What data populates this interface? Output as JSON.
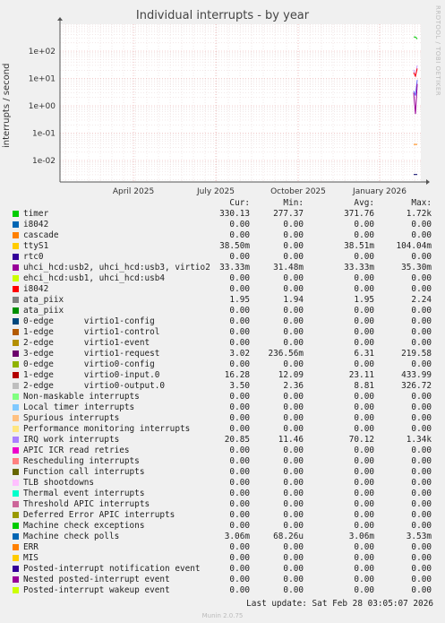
{
  "title": "Individual interrupts - by year",
  "side_label": "RRDTOOL / TOBI OETIKER",
  "footer": {
    "last_update": "Last update: Sat Feb 28 03:05:07 2026",
    "version": "Munin 2.0.75"
  },
  "chart_data": {
    "type": "line",
    "title": "Individual interrupts - by year",
    "ylabel": "interrupts / second",
    "yscale": "log",
    "y_ticks": [
      "1e-02",
      "1e-01",
      "1e+00",
      "1e+01",
      "1e+02"
    ],
    "ylim": [
      0.003,
      1000
    ],
    "x_ticks": [
      "April 2025",
      "July 2025",
      "October 2025",
      "January 2026"
    ],
    "grid": true,
    "visible_series": [
      {
        "name": "timer",
        "color": "#00cc00",
        "values": [
          330.13,
          330.13,
          277.37
        ]
      },
      {
        "name": "IRQ work interrupts",
        "color": "#cc99ff",
        "values": [
          20.85,
          11.46,
          30
        ]
      },
      {
        "name": "1-edge virtio0-input.0",
        "color": "#ff0000",
        "values": [
          16.28,
          12.09,
          23.11
        ]
      },
      {
        "name": "ttyS1",
        "color": "#ff8000",
        "values": [
          0.0385,
          0.0385,
          0.0385
        ]
      },
      {
        "name": "Machine check polls",
        "color": "#000066",
        "values": [
          0.00306,
          0.00306,
          0.00306
        ]
      },
      {
        "name": "2-edge virtio0-output.0",
        "color": "#6666ff",
        "values": [
          3.5,
          2.36,
          8.81
        ]
      },
      {
        "name": "3-edge virtio1-request",
        "color": "#990099",
        "values": [
          3.02,
          0.5,
          6.31
        ]
      }
    ]
  },
  "legend": {
    "headers": [
      "Cur:",
      "Min:",
      "Avg:",
      "Max:"
    ],
    "rows": [
      {
        "name": "timer",
        "color": "#00cc00",
        "cur": "330.13",
        "min": "277.37",
        "avg": "371.76",
        "max": "1.72k"
      },
      {
        "name": "i8042",
        "color": "#0066b3",
        "cur": "0.00",
        "min": "0.00",
        "avg": "0.00",
        "max": "0.00"
      },
      {
        "name": "cascade",
        "color": "#ff8000",
        "cur": "0.00",
        "min": "0.00",
        "avg": "0.00",
        "max": "0.00"
      },
      {
        "name": "ttyS1",
        "color": "#ffcc00",
        "cur": "38.50m",
        "min": "0.00",
        "avg": "38.51m",
        "max": "104.04m"
      },
      {
        "name": "rtc0",
        "color": "#330099",
        "cur": "0.00",
        "min": "0.00",
        "avg": "0.00",
        "max": "0.00"
      },
      {
        "name": "uhci_hcd:usb2, uhci_hcd:usb3, virtio2",
        "color": "#990099",
        "cur": "33.33m",
        "min": "31.48m",
        "avg": "33.33m",
        "max": "35.30m"
      },
      {
        "name": "ehci_hcd:usb1, uhci_hcd:usb4",
        "color": "#ccff00",
        "cur": "0.00",
        "min": "0.00",
        "avg": "0.00",
        "max": "0.00"
      },
      {
        "name": "i8042",
        "color": "#ff0000",
        "cur": "0.00",
        "min": "0.00",
        "avg": "0.00",
        "max": "0.00"
      },
      {
        "name": "ata_piix",
        "color": "#808080",
        "cur": "1.95",
        "min": "1.94",
        "avg": "1.95",
        "max": "2.24"
      },
      {
        "name": "ata_piix",
        "color": "#008f00",
        "cur": "0.00",
        "min": "0.00",
        "avg": "0.00",
        "max": "0.00"
      },
      {
        "name": "0-edge      virtio1-config",
        "color": "#00487d",
        "cur": "0.00",
        "min": "0.00",
        "avg": "0.00",
        "max": "0.00"
      },
      {
        "name": "1-edge      virtio1-control",
        "color": "#b35a00",
        "cur": "0.00",
        "min": "0.00",
        "avg": "0.00",
        "max": "0.00"
      },
      {
        "name": "2-edge      virtio1-event",
        "color": "#b38f00",
        "cur": "0.00",
        "min": "0.00",
        "avg": "0.00",
        "max": "0.00"
      },
      {
        "name": "3-edge      virtio1-request",
        "color": "#6b006b",
        "cur": "3.02",
        "min": "236.56m",
        "avg": "6.31",
        "max": "219.58"
      },
      {
        "name": "0-edge      virtio0-config",
        "color": "#8fb300",
        "cur": "0.00",
        "min": "0.00",
        "avg": "0.00",
        "max": "0.00"
      },
      {
        "name": "1-edge      virtio0-input.0",
        "color": "#b30000",
        "cur": "16.28",
        "min": "12.09",
        "avg": "23.11",
        "max": "433.99"
      },
      {
        "name": "2-edge      virtio0-output.0",
        "color": "#bebebe",
        "cur": "3.50",
        "min": "2.36",
        "avg": "8.81",
        "max": "326.72"
      },
      {
        "name": "Non-maskable interrupts",
        "color": "#80ff80",
        "cur": "0.00",
        "min": "0.00",
        "avg": "0.00",
        "max": "0.00"
      },
      {
        "name": "Local timer interrupts",
        "color": "#80c9ff",
        "cur": "0.00",
        "min": "0.00",
        "avg": "0.00",
        "max": "0.00"
      },
      {
        "name": "Spurious interrupts",
        "color": "#ffc080",
        "cur": "0.00",
        "min": "0.00",
        "avg": "0.00",
        "max": "0.00"
      },
      {
        "name": "Performance monitoring interrupts",
        "color": "#ffe680",
        "cur": "0.00",
        "min": "0.00",
        "avg": "0.00",
        "max": "0.00"
      },
      {
        "name": "IRQ work interrupts",
        "color": "#aa80ff",
        "cur": "20.85",
        "min": "11.46",
        "avg": "70.12",
        "max": "1.34k"
      },
      {
        "name": "APIC ICR read retries",
        "color": "#ee00cc",
        "cur": "0.00",
        "min": "0.00",
        "avg": "0.00",
        "max": "0.00"
      },
      {
        "name": "Rescheduling interrupts",
        "color": "#ff8080",
        "cur": "0.00",
        "min": "0.00",
        "avg": "0.00",
        "max": "0.00"
      },
      {
        "name": "Function call interrupts",
        "color": "#666600",
        "cur": "0.00",
        "min": "0.00",
        "avg": "0.00",
        "max": "0.00"
      },
      {
        "name": "TLB shootdowns",
        "color": "#ffbfff",
        "cur": "0.00",
        "min": "0.00",
        "avg": "0.00",
        "max": "0.00"
      },
      {
        "name": "Thermal event interrupts",
        "color": "#00ffcc",
        "cur": "0.00",
        "min": "0.00",
        "avg": "0.00",
        "max": "0.00"
      },
      {
        "name": "Threshold APIC interrupts",
        "color": "#cc6699",
        "cur": "0.00",
        "min": "0.00",
        "avg": "0.00",
        "max": "0.00"
      },
      {
        "name": "Deferred Error APIC interrupts",
        "color": "#999900",
        "cur": "0.00",
        "min": "0.00",
        "avg": "0.00",
        "max": "0.00"
      },
      {
        "name": "Machine check exceptions",
        "color": "#00cc00",
        "cur": "0.00",
        "min": "0.00",
        "avg": "0.00",
        "max": "0.00"
      },
      {
        "name": "Machine check polls",
        "color": "#0066b3",
        "cur": "3.06m",
        "min": "68.26u",
        "avg": "3.06m",
        "max": "3.53m"
      },
      {
        "name": "ERR",
        "color": "#ff8000",
        "cur": "0.00",
        "min": "0.00",
        "avg": "0.00",
        "max": "0.00"
      },
      {
        "name": "MIS",
        "color": "#ffcc00",
        "cur": "0.00",
        "min": "0.00",
        "avg": "0.00",
        "max": "0.00"
      },
      {
        "name": "Posted-interrupt notification event",
        "color": "#330099",
        "cur": "0.00",
        "min": "0.00",
        "avg": "0.00",
        "max": "0.00"
      },
      {
        "name": "Nested posted-interrupt event",
        "color": "#990099",
        "cur": "0.00",
        "min": "0.00",
        "avg": "0.00",
        "max": "0.00"
      },
      {
        "name": "Posted-interrupt wakeup event",
        "color": "#ccff00",
        "cur": "0.00",
        "min": "0.00",
        "avg": "0.00",
        "max": "0.00"
      }
    ]
  }
}
